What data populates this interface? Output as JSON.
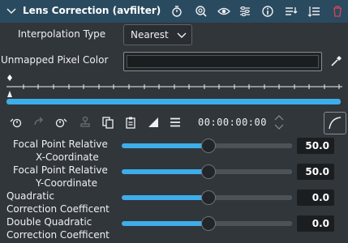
{
  "header": {
    "title": "Lens Correction (avfilter)",
    "icons": [
      "stopwatch-icon",
      "zoom-icon",
      "eye-icon",
      "settings-icon",
      "info-icon",
      "save-preset-icon",
      "collapse-icon",
      "delete-icon"
    ],
    "colors": {
      "background": "#2a4a60",
      "delete": "#da4453"
    }
  },
  "interpolation": {
    "label": "Interpolation Type",
    "value": "Nearest"
  },
  "unmapped": {
    "label": "Unmapped Pixel Color",
    "color": "#1b1e20"
  },
  "toolbar": {
    "timecode": "00:00:00:00",
    "icons": [
      "previous-keyframe-icon",
      "redo-icon",
      "next-keyframe-icon",
      "stamp-icon",
      "copy-icon",
      "paste-icon",
      "ramp-icon",
      "menu-icon",
      "spin-arrows-icon",
      "curve-icon"
    ]
  },
  "params": [
    {
      "label_line1": "Focal Point Relative",
      "label_line2": "X-Coordinate",
      "value": "50.0",
      "fraction": 0.5
    },
    {
      "label_line1": "Focal Point Relative",
      "label_line2": "Y-Coordinate",
      "value": "50.0",
      "fraction": 0.5
    },
    {
      "label_line1": "Quadratic",
      "label_line2": "Correction Coefficent",
      "value": "0.0",
      "fraction": 0.5
    },
    {
      "label_line1": "Double Quadratic",
      "label_line2": "Correction Coefficent",
      "value": "0.0",
      "fraction": 0.5
    }
  ],
  "accent": "#3daee9"
}
